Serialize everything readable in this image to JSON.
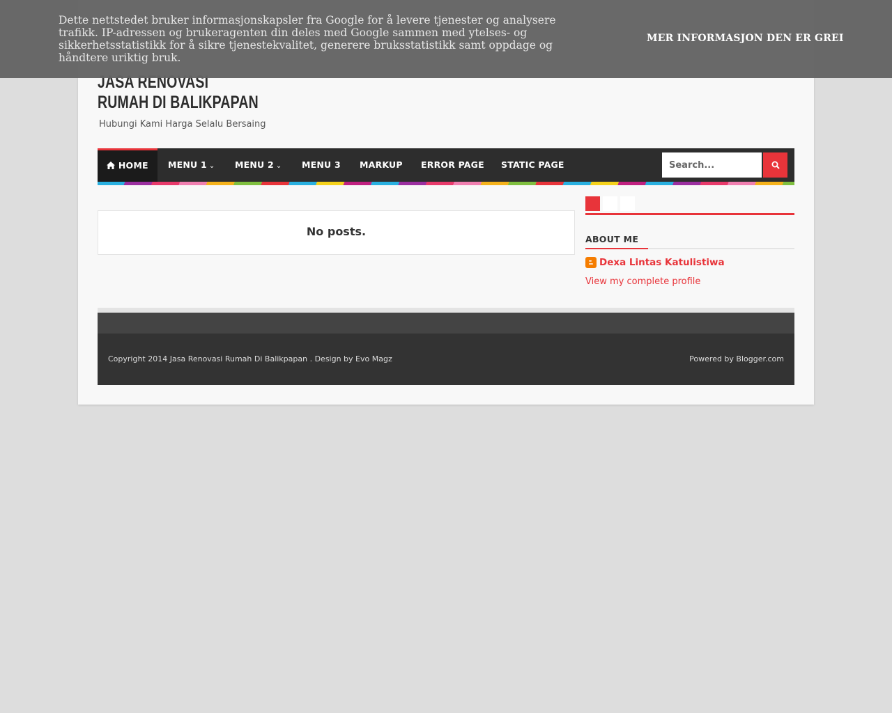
{
  "header": {
    "title": "JASA RENOVASI RUMAH DI BALIKPAPAN",
    "description": "Hubungi Kami Harga Selalu Bersaing"
  },
  "nav": {
    "items": [
      {
        "label": "HOME",
        "icon": "home-icon"
      },
      {
        "label": "MENU 1",
        "dropdown": true
      },
      {
        "label": "MENU 2",
        "dropdown": true
      },
      {
        "label": "MENU 3"
      },
      {
        "label": "MARKUP"
      },
      {
        "label": "ERROR PAGE"
      },
      {
        "label": "STATIC PAGE"
      }
    ],
    "search_placeholder": "Search..."
  },
  "main": {
    "no_posts": "No posts."
  },
  "sidebar": {
    "tabs": [
      "#e8343a",
      "#ffffff",
      "#ffffff"
    ],
    "about_title": "ABOUT ME",
    "profile_name": "Dexa Lintas Katulistiwa",
    "profile_link": "View my complete profile"
  },
  "footer": {
    "copyright": "Copyright 2014 Jasa Renovasi Rumah Di Balikpapan . Design by Evo Magz",
    "powered": "Powered by Blogger.com"
  },
  "cookie": {
    "text": "Dette nettstedet bruker informasjonskapsler fra Google for å levere tjenester og analysere trafikk. IP-adressen og brukeragenten din deles med Google sammen med ytelses- og sikkerhetsstatistikk for å sikre tjenestekvalitet, generere bruksstatistikk samt oppdage og håndtere uriktig bruk.",
    "more_info": "MER INFORMASJON",
    "ok": "DEN ER GREI"
  },
  "colors": {
    "accent": "#e8343a",
    "nav_bg": "#2d2d2d",
    "footer_bg": "#333333",
    "page_bg": "#dddddd"
  }
}
